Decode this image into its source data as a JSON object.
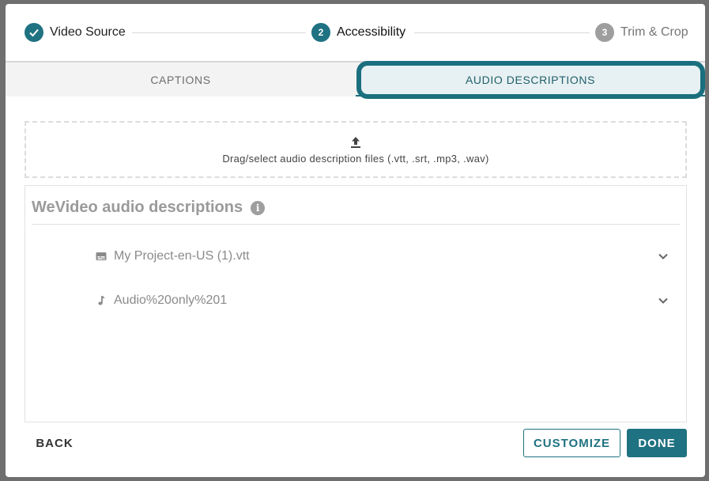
{
  "stepper": {
    "steps": [
      {
        "label": "Video Source",
        "status": "completed",
        "marker": "✓"
      },
      {
        "label": "Accessibility",
        "status": "active",
        "marker": "2"
      },
      {
        "label": "Trim & Crop",
        "status": "pending",
        "marker": "3"
      }
    ]
  },
  "tabs": {
    "items": [
      {
        "label": "CAPTIONS",
        "active": false
      },
      {
        "label": "AUDIO DESCRIPTIONS",
        "active": true
      }
    ]
  },
  "dropzone": {
    "icon": "upload-icon",
    "text": "Drag/select audio description files (.vtt, .srt, .mp3, .wav)"
  },
  "panel": {
    "title": "WeVideo audio descriptions",
    "info_icon": "i",
    "files": [
      {
        "name": "My Project-en-US (1).vtt",
        "icon": "subtitles-icon"
      },
      {
        "name": "Audio%20only%201",
        "icon": "music-note-icon"
      }
    ]
  },
  "footer": {
    "back_label": "BACK",
    "customize_label": "CUSTOMIZE",
    "done_label": "DONE"
  },
  "colors": {
    "accent": "#1f7281",
    "highlight": "#1a6f7e",
    "muted": "#9e9e9e"
  }
}
